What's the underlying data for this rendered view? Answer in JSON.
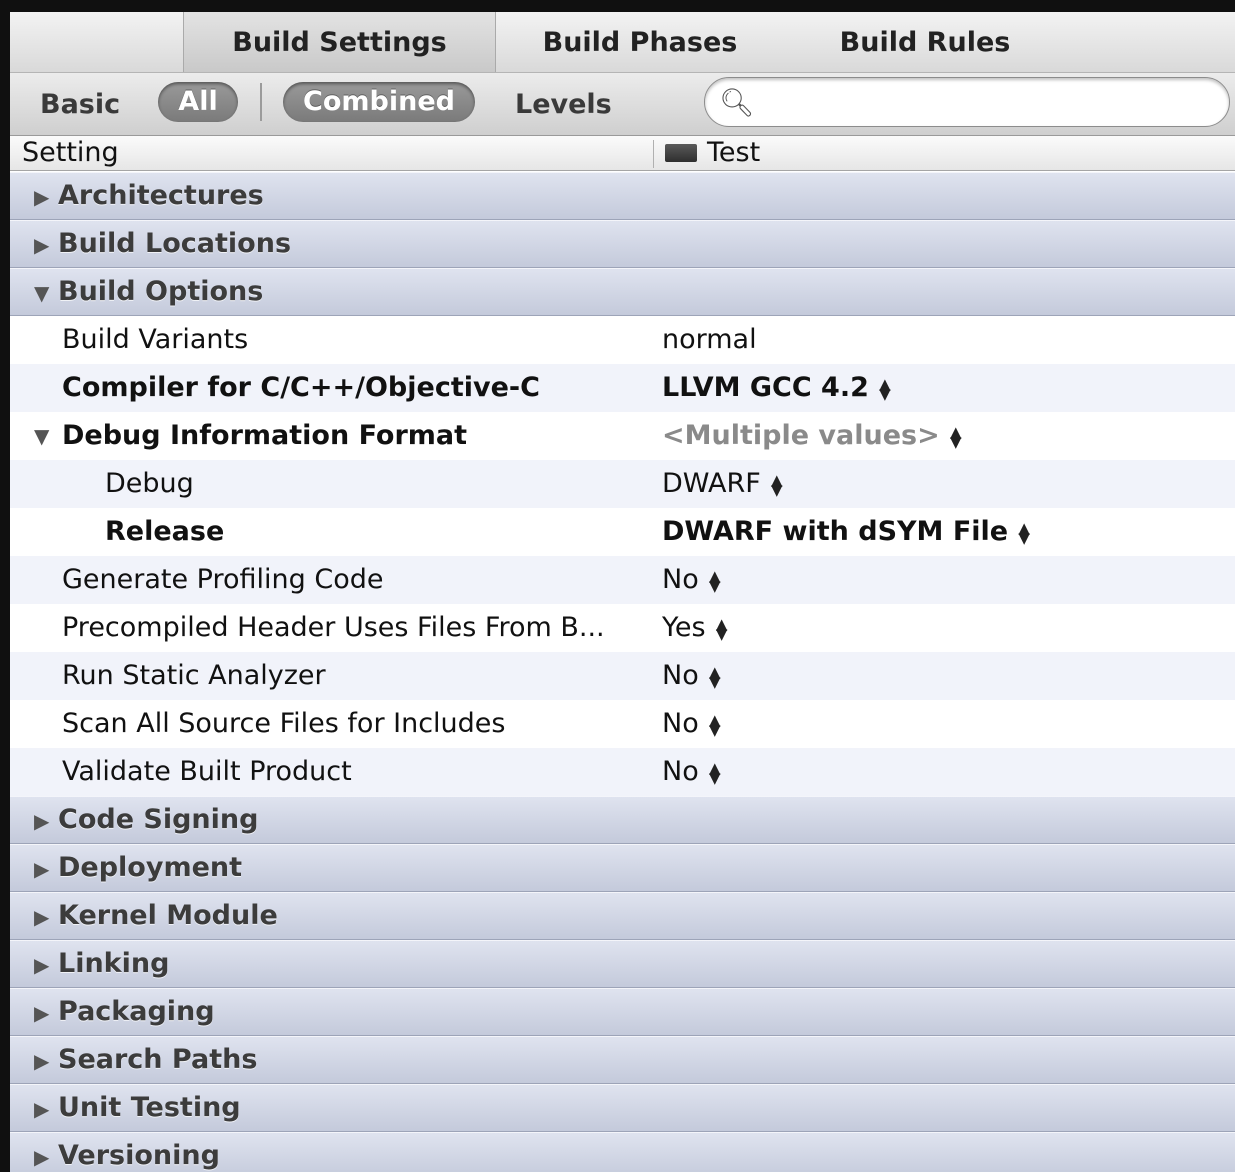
{
  "tabs": [
    {
      "label": "Build Settings",
      "selected": true
    },
    {
      "label": "Build Phases",
      "selected": false
    },
    {
      "label": "Build Rules",
      "selected": false
    }
  ],
  "filter": {
    "basic": "Basic",
    "all": "All",
    "combined": "Combined",
    "levels": "Levels",
    "search_placeholder": ""
  },
  "columns": {
    "setting": "Setting",
    "target": "Test"
  },
  "groups_before": [
    {
      "label": "Architectures"
    },
    {
      "label": "Build Locations"
    }
  ],
  "build_options": {
    "label": "Build Options",
    "rows": [
      {
        "label": "Build Variants",
        "value": "normal"
      },
      {
        "label": "Compiler for C/C++/Objective-C",
        "value": "LLVM GCC 4.2"
      },
      {
        "label": "Debug Information Format",
        "value": "<Multiple values>"
      },
      {
        "label": "Debug",
        "value": "DWARF"
      },
      {
        "label": "Release",
        "value": "DWARF with dSYM File"
      },
      {
        "label": "Generate Profiling Code",
        "value": "No"
      },
      {
        "label": "Precompiled Header Uses Files From B...",
        "value": "Yes"
      },
      {
        "label": "Run Static Analyzer",
        "value": "No"
      },
      {
        "label": "Scan All Source Files for Includes",
        "value": "No"
      },
      {
        "label": "Validate Built Product",
        "value": "No"
      }
    ]
  },
  "groups_after": [
    {
      "label": "Code Signing"
    },
    {
      "label": "Deployment"
    },
    {
      "label": "Kernel Module"
    },
    {
      "label": "Linking"
    },
    {
      "label": "Packaging"
    },
    {
      "label": "Search Paths"
    },
    {
      "label": "Unit Testing"
    },
    {
      "label": "Versioning"
    }
  ],
  "icons": {
    "collapsed": "disclosure-triangle-right-icon",
    "expanded": "disclosure-triangle-down-icon",
    "search": "search-icon",
    "stepper": "stepper-arrows-icon",
    "target": "target-icon"
  }
}
